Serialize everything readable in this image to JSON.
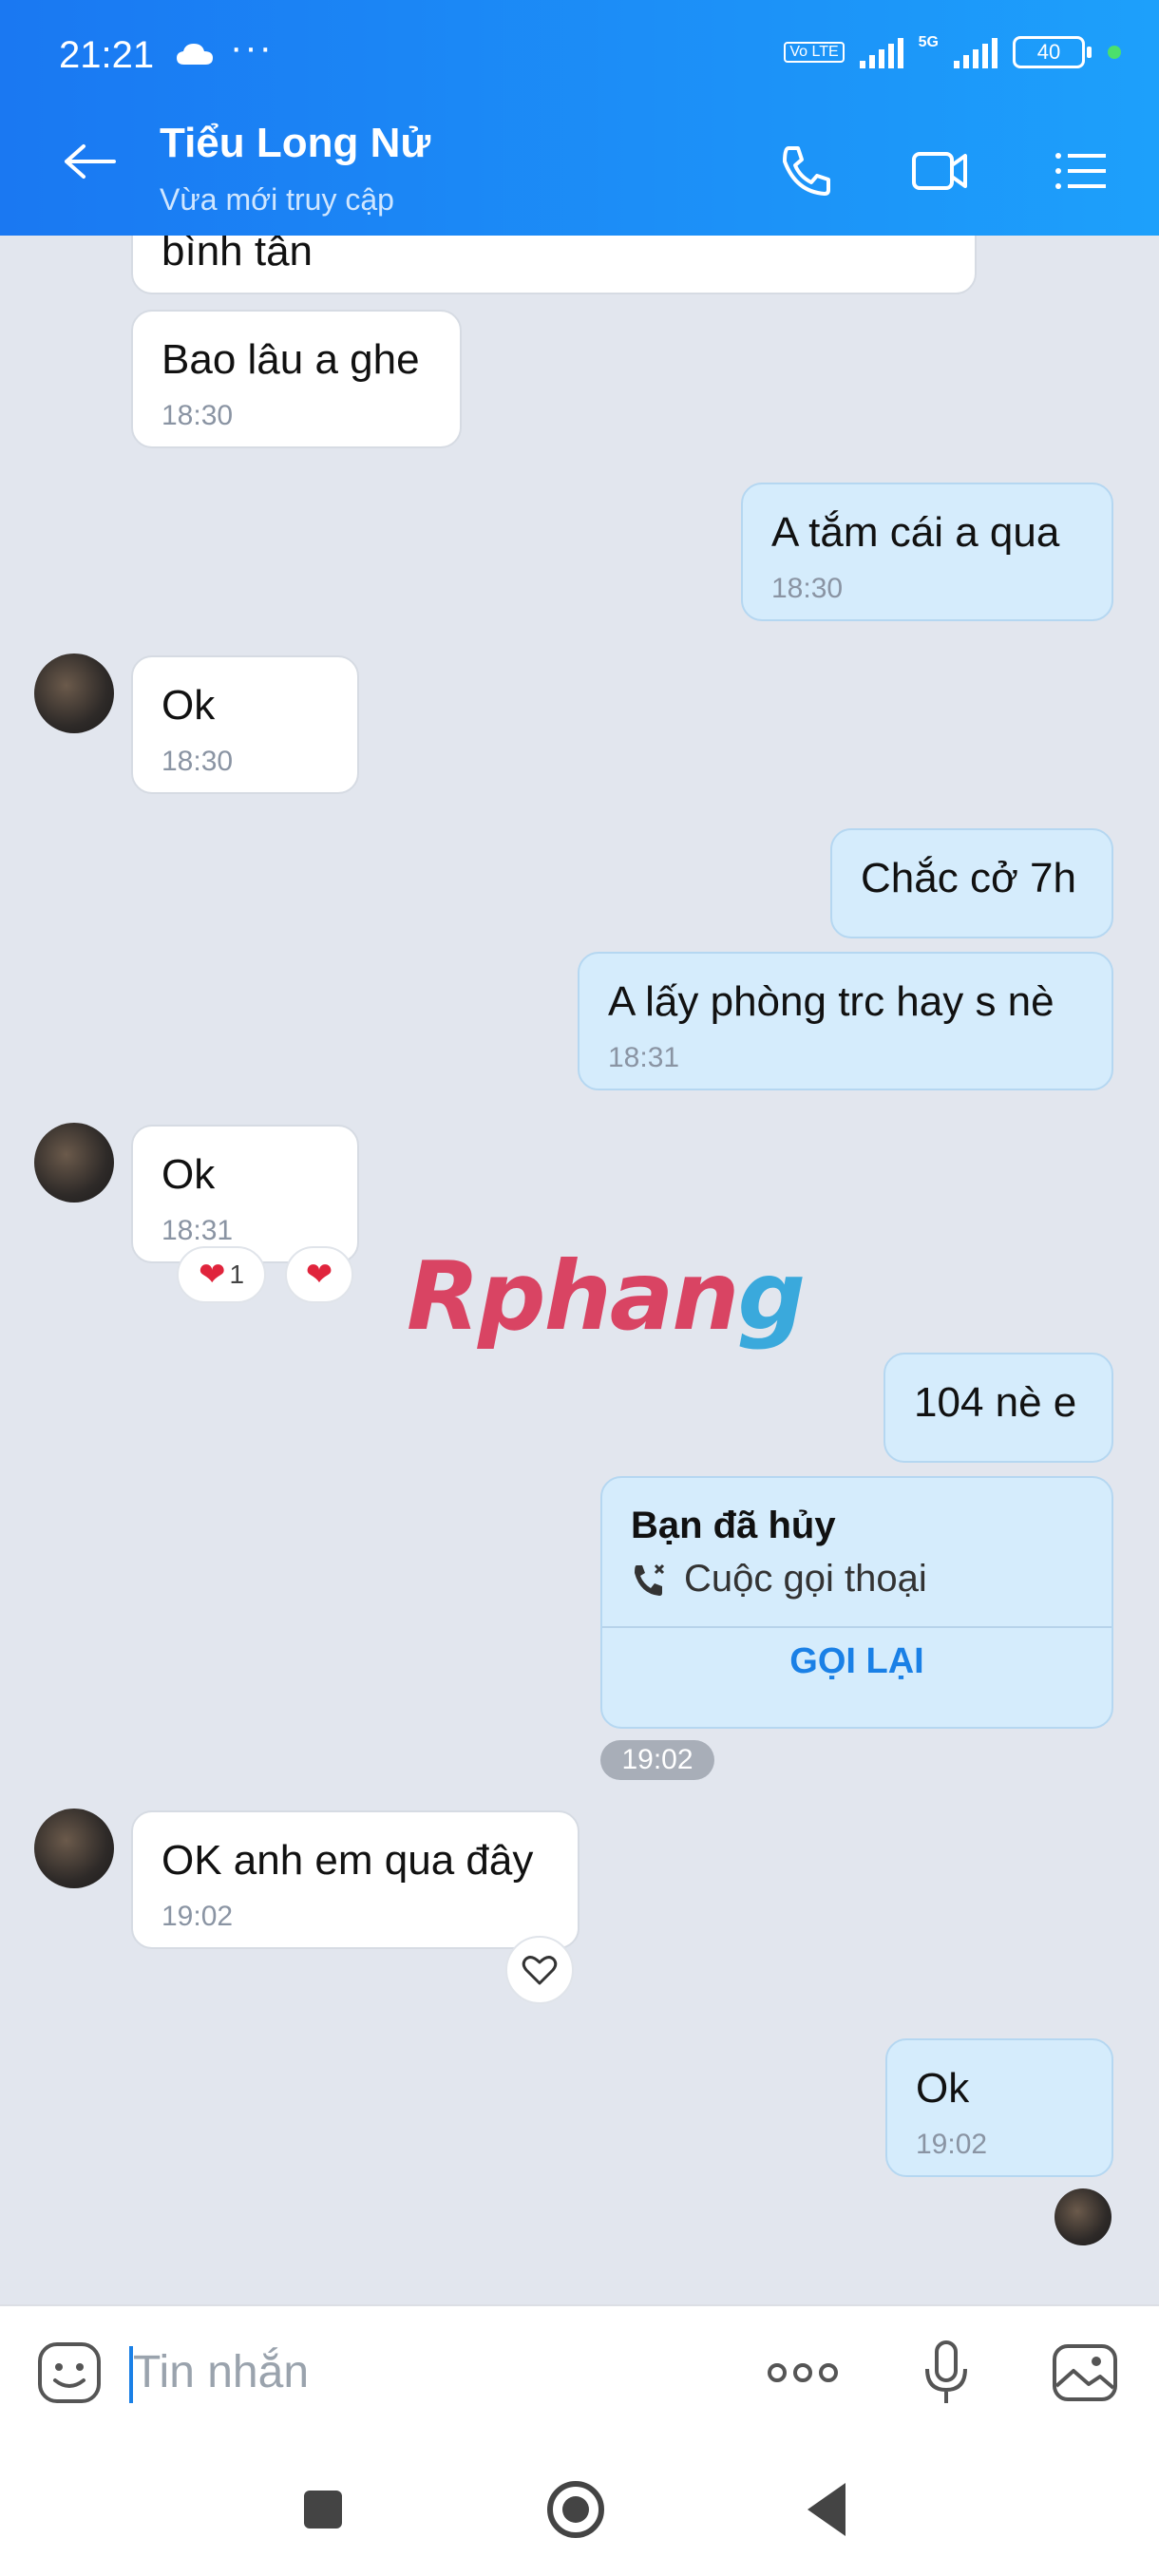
{
  "status_bar": {
    "time": "21:21",
    "dots": "···",
    "volte": "Vo LTE",
    "network": "5G",
    "battery": "40"
  },
  "header": {
    "title": "Tiểu Long Nử",
    "subtitle": "Vừa mới truy cập"
  },
  "messages": [
    {
      "side": "in",
      "text": "bình tân",
      "time": ""
    },
    {
      "side": "in",
      "text": "Bao lâu a ghe",
      "time": "18:30"
    },
    {
      "side": "out",
      "text": "A tắm cái a qua",
      "time": "18:30"
    },
    {
      "side": "in",
      "text": "Ok",
      "time": "18:30"
    },
    {
      "side": "out",
      "text": "Chắc cở 7h",
      "time": ""
    },
    {
      "side": "out",
      "text": "A lấy phòng trc hay s nè",
      "time": "18:31"
    },
    {
      "side": "in",
      "text": "Ok",
      "time": "18:31"
    },
    {
      "side": "out",
      "text": "104 nè e",
      "time": ""
    },
    {
      "side": "in",
      "text": "OK anh em qua đây",
      "time": "19:02"
    },
    {
      "side": "out",
      "text": "Ok",
      "time": "19:02"
    }
  ],
  "reactions": {
    "count": "1"
  },
  "call_card": {
    "title": "Bạn đã hủy",
    "subtitle": "Cuộc gọi thoại",
    "action": "GỌI LẠI",
    "time": "19:02"
  },
  "watermark": {
    "part1": "Rphan",
    "part2": "g"
  },
  "input": {
    "placeholder": "Tin nhắn"
  }
}
